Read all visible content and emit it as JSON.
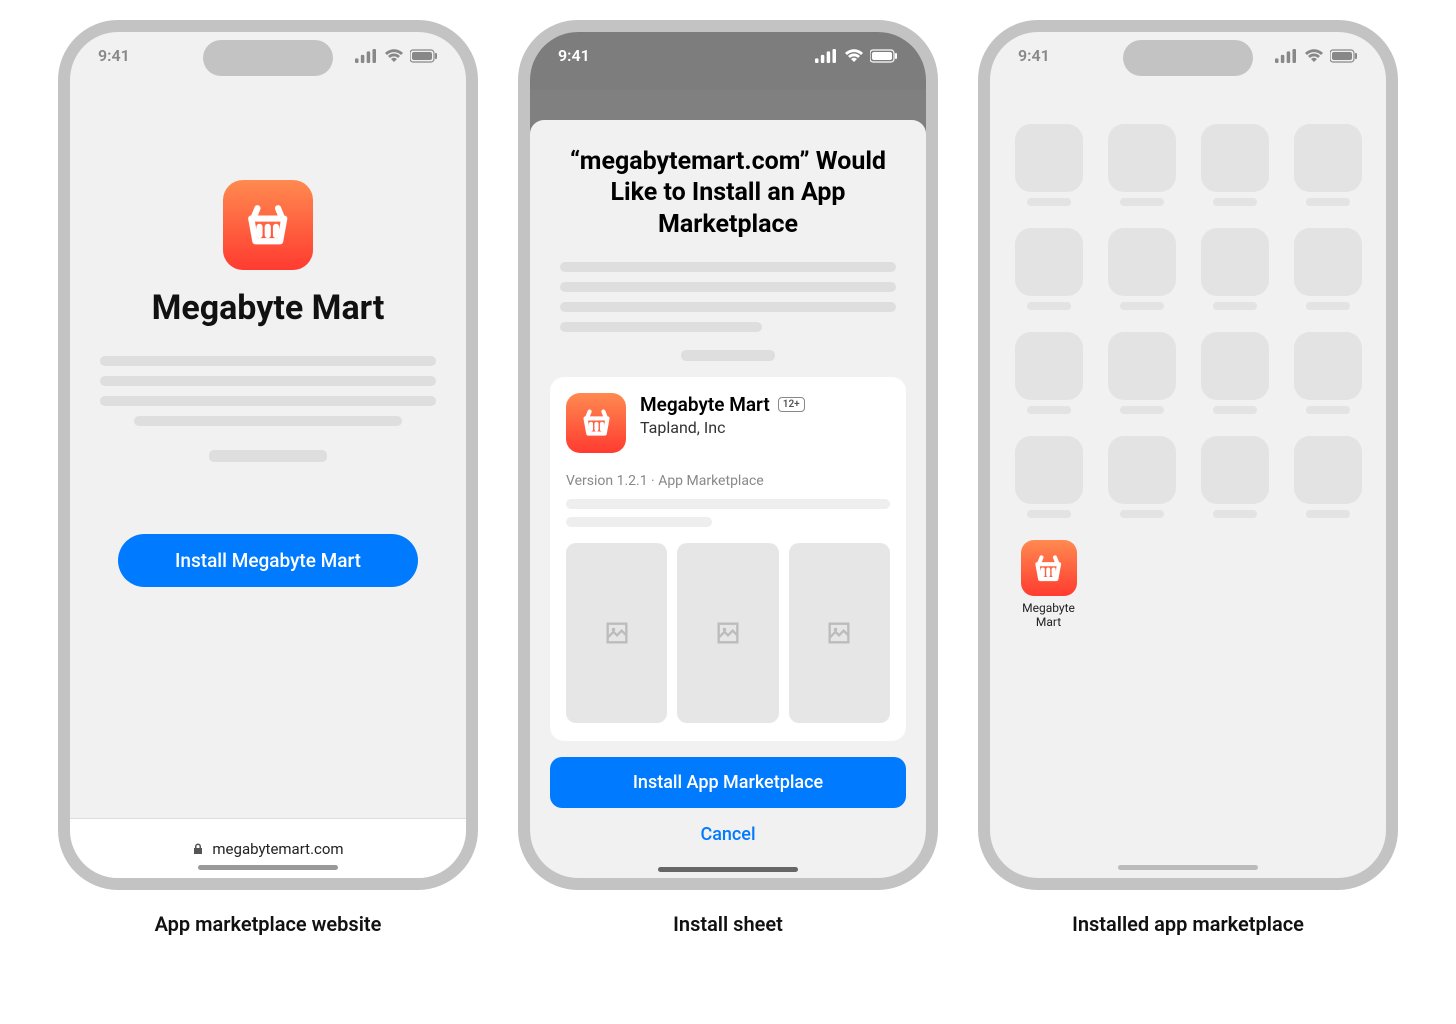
{
  "status_time": "9:41",
  "phone1": {
    "app_name": "Megabyte Mart",
    "install_button": "Install Megabyte Mart",
    "url_domain": "megabytemart.com",
    "caption": "App marketplace website"
  },
  "phone2": {
    "sheet_title": "“megabytemart.com” Would Like to Install an App Marketplace",
    "card": {
      "title": "Megabyte Mart",
      "age_rating": "12+",
      "developer": "Tapland, Inc",
      "meta": "Version 1.2.1 · App Marketplace"
    },
    "primary_button": "Install App Marketplace",
    "cancel_button": "Cancel",
    "caption": "Install sheet"
  },
  "phone3": {
    "app_label": "Megabyte Mart",
    "caption": "Installed app marketplace"
  }
}
